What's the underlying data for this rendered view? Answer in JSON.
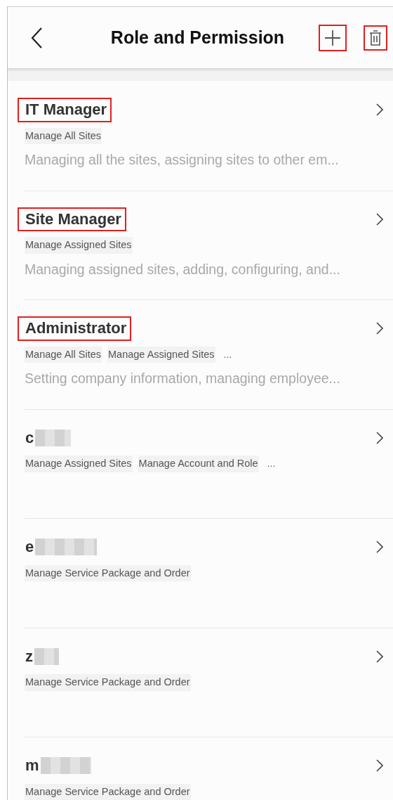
{
  "header": {
    "title": "Role and Permission",
    "add_highlighted": true,
    "delete_highlighted": true
  },
  "roles": [
    {
      "name": "IT Manager",
      "redacted": false,
      "highlighted": true,
      "tags": [
        "Manage All Sites"
      ],
      "description": "Managing all the sites, assigning sites to other em..."
    },
    {
      "name": "Site Manager",
      "redacted": false,
      "highlighted": true,
      "tags": [
        "Manage Assigned Sites"
      ],
      "description": "Managing assigned sites, adding, configuring, and..."
    },
    {
      "name": "Administrator",
      "redacted": false,
      "highlighted": true,
      "tags": [
        "Manage All Sites",
        "Manage Assigned Sites"
      ],
      "more": "...",
      "description": "Setting company information, managing employee..."
    },
    {
      "name": "c",
      "redacted": true,
      "highlighted": false,
      "tags": [
        "Manage Assigned Sites",
        "Manage Account and Role"
      ],
      "more": "..."
    },
    {
      "name": "e",
      "redacted": true,
      "highlighted": false,
      "tags": [
        "Manage Service Package and Order"
      ]
    },
    {
      "name": "z",
      "redacted": true,
      "highlighted": false,
      "tags": [
        "Manage Service Package and Order"
      ]
    },
    {
      "name": "m",
      "redacted": true,
      "highlighted": false,
      "tags": [
        "Manage Service Package and Order"
      ]
    }
  ]
}
